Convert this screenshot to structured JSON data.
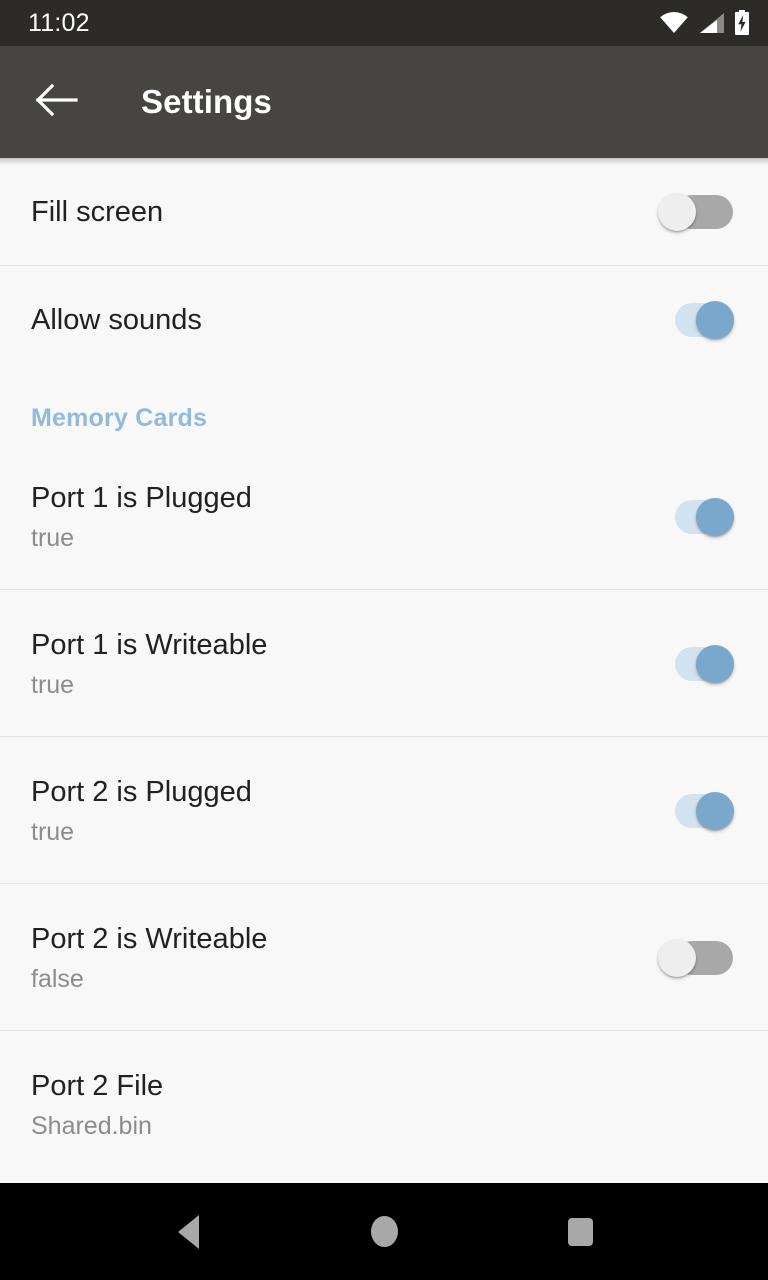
{
  "status_bar": {
    "time": "11:02",
    "icons": [
      "wifi-icon",
      "cell-signal-icon",
      "battery-charging-icon"
    ],
    "background_color": "#2d2b28"
  },
  "app_bar": {
    "back_label": "back-arrow-icon",
    "title": "Settings",
    "background_color": "#474542",
    "title_color": "#ffffff"
  },
  "colors": {
    "content_background": "#f8f8f8",
    "divider": "#e2e2e2",
    "section_header": "#92bada",
    "switch_on_thumb": "#7aa8cd",
    "switch_on_track": "#d3e2ef",
    "switch_off_thumb": "#eeeeee",
    "switch_off_track": "#a8a8a8",
    "primary_text": "#212121",
    "secondary_text": "#8c8c8c"
  },
  "settings": {
    "general_rows": [
      {
        "title": "Fill screen",
        "subtitle": "",
        "switch": "off",
        "divider": true
      },
      {
        "title": "Allow sounds",
        "subtitle": "",
        "switch": "on",
        "divider": false
      }
    ],
    "section": {
      "header": "Memory Cards",
      "rows": [
        {
          "title": "Port 1 is Plugged",
          "subtitle": "true",
          "switch": "on",
          "divider": true
        },
        {
          "title": "Port 1 is Writeable",
          "subtitle": "true",
          "switch": "on",
          "divider": true
        },
        {
          "title": "Port 2 is Plugged",
          "subtitle": "true",
          "switch": "on",
          "divider": true
        },
        {
          "title": "Port 2 is Writeable",
          "subtitle": "false",
          "switch": "off",
          "divider": true
        },
        {
          "title": "Port 2 File",
          "subtitle": "Shared.bin",
          "switch": "none",
          "divider": false
        }
      ]
    }
  },
  "nav_bar": {
    "buttons": [
      "back-triangle-icon",
      "home-circle-icon",
      "recents-square-icon"
    ],
    "background_color": "#000000",
    "icon_color": "#a8a8a8"
  }
}
